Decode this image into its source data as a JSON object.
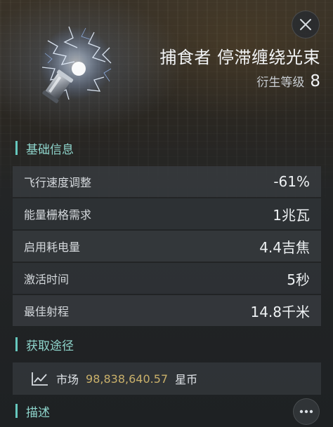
{
  "item": {
    "name": "捕食者 停滞缠绕光束",
    "tier_label": "衍生等级",
    "tier_value": "8",
    "icon": "stasis-webifier-module-icon"
  },
  "sections": {
    "basic_info": "基础信息",
    "acquire": "获取途径",
    "description": "描述"
  },
  "attributes": [
    {
      "label": "飞行速度调整",
      "value": "-61%"
    },
    {
      "label": "能量栅格需求",
      "value": "1兆瓦"
    },
    {
      "label": "启用耗电量",
      "value": "4.4吉焦"
    },
    {
      "label": "激活时间",
      "value": "5秒"
    },
    {
      "label": "最佳射程",
      "value": "14.8千米"
    }
  ],
  "market": {
    "label": "市场",
    "price": "98,838,640.57",
    "unit": "星币",
    "icon": "trend-chart-icon"
  },
  "controls": {
    "close_icon": "close-icon",
    "more_icon": "more-options-icon"
  },
  "colors": {
    "accent": "#66c8be",
    "price": "#c9b06a"
  }
}
